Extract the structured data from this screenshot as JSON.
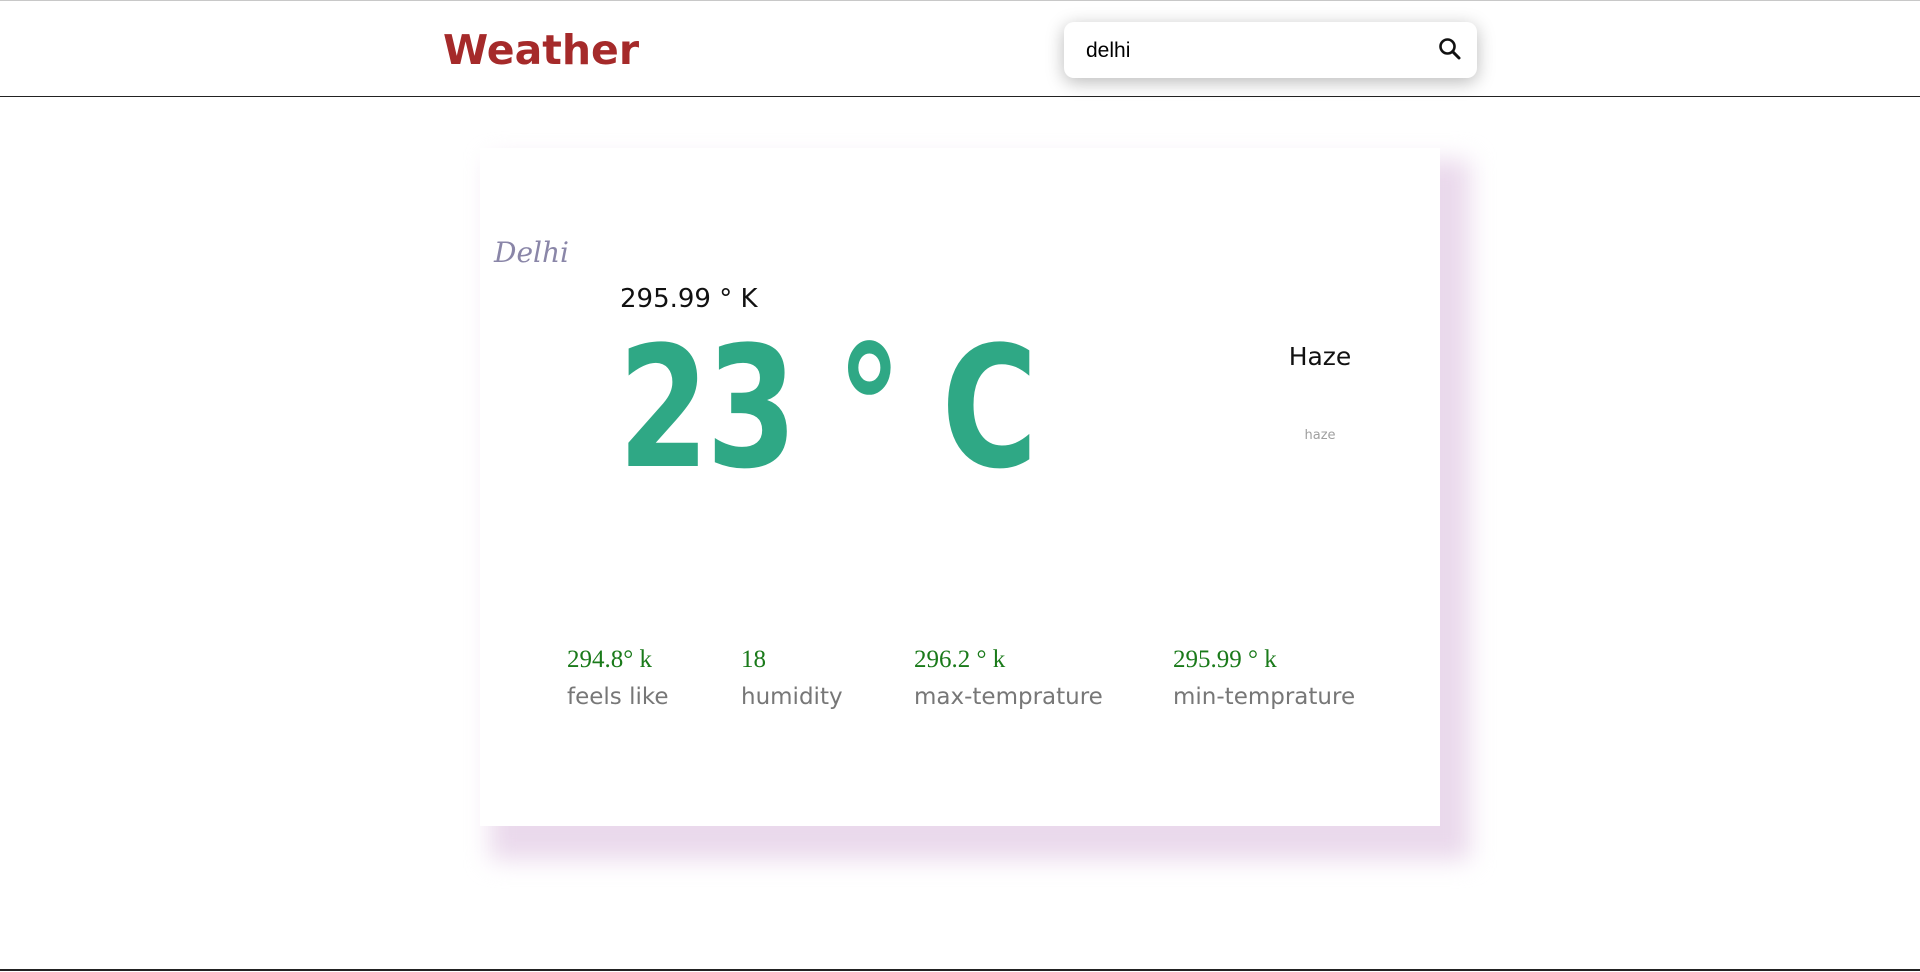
{
  "header": {
    "brand": "Weather"
  },
  "search": {
    "value": "delhi",
    "icon": "search-icon"
  },
  "weather": {
    "city": "Delhi",
    "kelvin": "295.99 ° K",
    "celsius": "23 ° C",
    "condition": "Haze",
    "description": "haze"
  },
  "stats": [
    {
      "value": "294.8° k",
      "label": "feels like"
    },
    {
      "value": "18",
      "label": "humidity"
    },
    {
      "value": "296.2 ° k",
      "label": "max-temprature"
    },
    {
      "value": "295.99 ° k",
      "label": "min-temprature"
    }
  ],
  "colors": {
    "brand": "#a52a2a",
    "temperature": "#2fa885",
    "stat_value": "#1a7a1a",
    "card_shadow": "#ead9ec"
  }
}
